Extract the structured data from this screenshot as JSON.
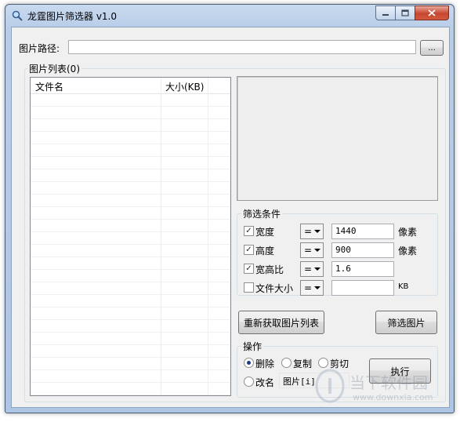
{
  "window": {
    "title": "龙霆图片筛选器 v1.0"
  },
  "path": {
    "label": "图片路径:",
    "value": "",
    "browse_label": "..."
  },
  "list": {
    "group_label": "图片列表(0)",
    "columns": [
      "文件名",
      "大小(KB)"
    ],
    "rows": []
  },
  "filter": {
    "group_label": "筛选条件",
    "rows": [
      {
        "checked": true,
        "label": "宽度",
        "op": "=",
        "value": "1440",
        "unit": "像素"
      },
      {
        "checked": true,
        "label": "高度",
        "op": "=",
        "value": "900",
        "unit": "像素"
      },
      {
        "checked": true,
        "label": "宽高比",
        "op": "=",
        "value": "1.6",
        "unit": ""
      },
      {
        "checked": false,
        "label": "文件大小",
        "op": "=",
        "value": "",
        "unit": "KB"
      }
    ],
    "refresh_button": "重新获取图片列表",
    "filter_button": "筛选图片"
  },
  "operation": {
    "group_label": "操作",
    "options": [
      {
        "label": "删除",
        "selected": true
      },
      {
        "label": "复制",
        "selected": false
      },
      {
        "label": "剪切",
        "selected": false
      },
      {
        "label": "改名",
        "selected": false
      }
    ],
    "rename_pattern": "图片[i]",
    "execute_button": "执行"
  },
  "watermark": {
    "name": "当下软件园",
    "url": "www.downxia.com"
  }
}
